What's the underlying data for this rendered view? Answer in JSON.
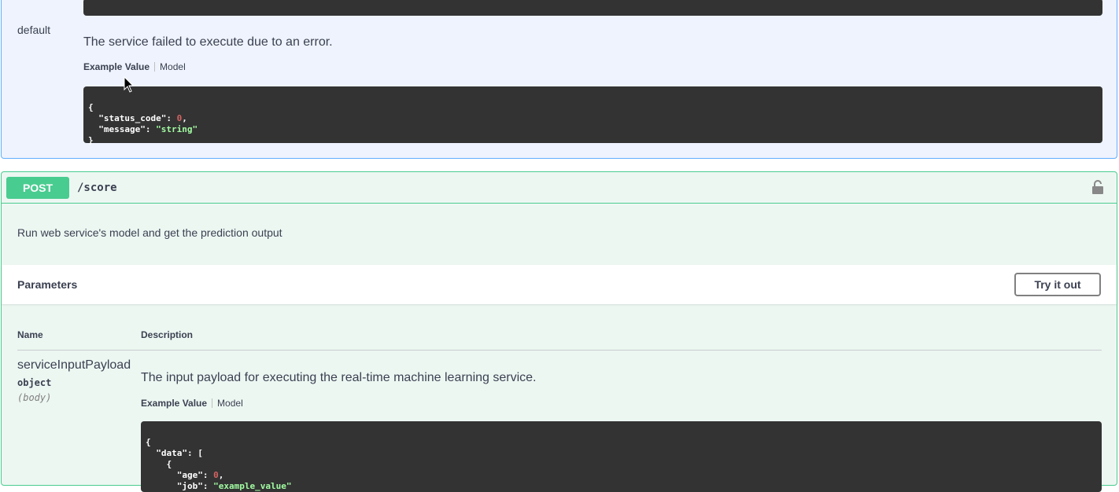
{
  "default_response": {
    "code": "default",
    "description": "The service failed to execute due to an error.",
    "tab_example": "Example Value",
    "tab_model": "Model",
    "example_lines": {
      "open": "{",
      "key1": "\"status_code\"",
      "val1": "0",
      "key2": "\"message\"",
      "val2": "\"string\"",
      "close": "}"
    }
  },
  "operation": {
    "method": "POST",
    "path": "/score",
    "summary": "Run web service's model and get the prediction output",
    "lock_icon": "lock-icon"
  },
  "parameters": {
    "title": "Parameters",
    "try_button": "Try it out",
    "col_name": "Name",
    "col_description": "Description",
    "items": [
      {
        "name": "serviceInputPayload",
        "type": "object",
        "in": "(body)",
        "description": "The input payload for executing the real-time machine learning service.",
        "tab_example": "Example Value",
        "tab_model": "Model",
        "example": {
          "l1": "{",
          "l2_key": "\"data\"",
          "l2_rest": ": [",
          "l3": "{",
          "l4_key": "\"age\"",
          "l4_val": "0",
          "l5_key": "\"job\"",
          "l5_val": "\"example_value\""
        }
      }
    ]
  },
  "colors": {
    "get_border": "#61affe",
    "get_bg": "#eef3fd",
    "post": "#49cc90",
    "post_bg": "#edf7f2",
    "code_bg": "#333333"
  }
}
